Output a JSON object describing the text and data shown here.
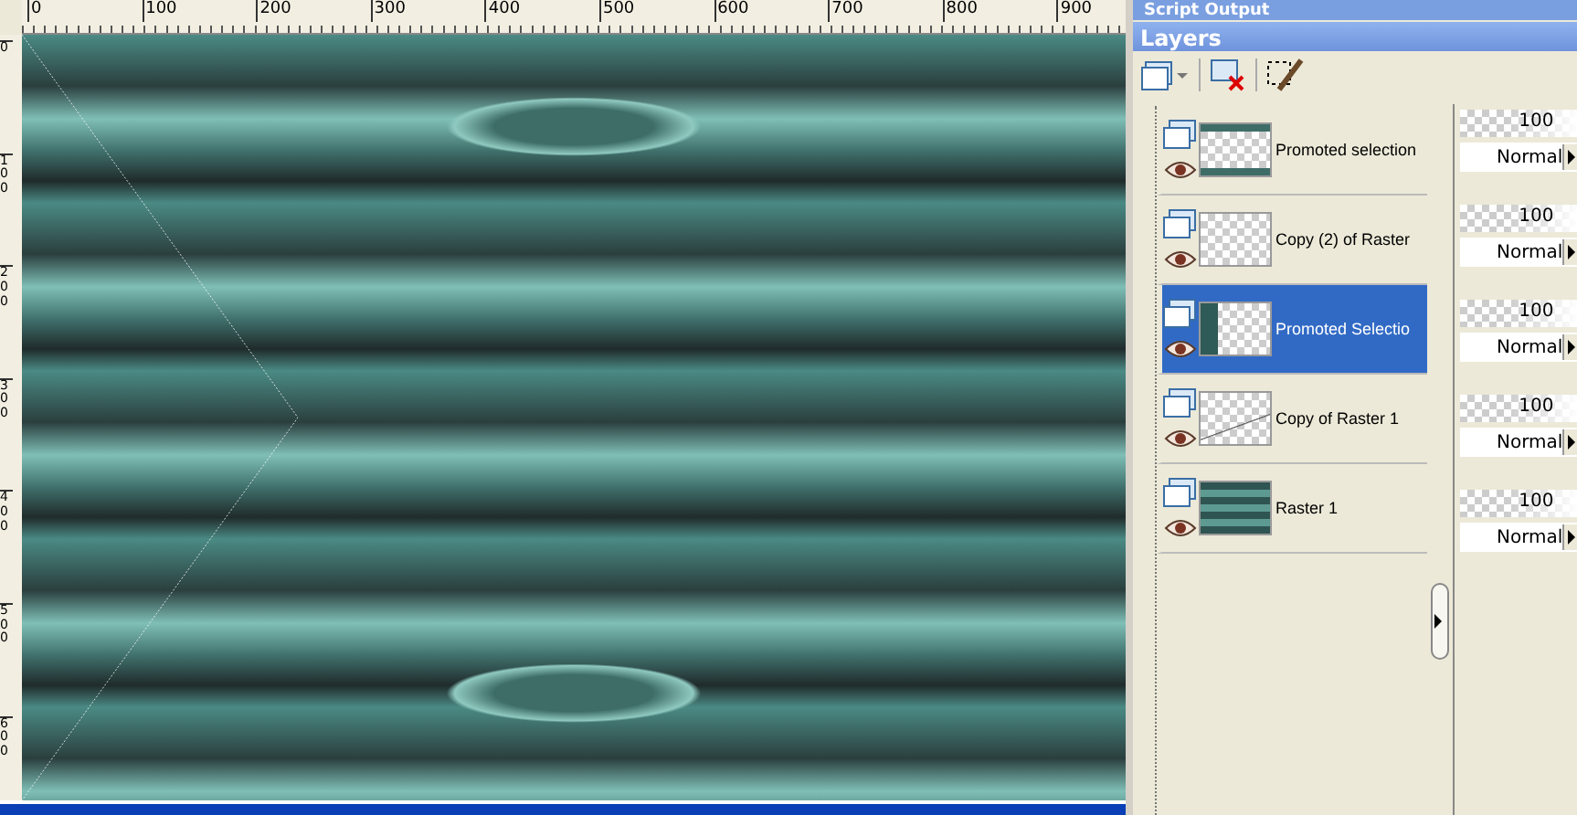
{
  "rulers": {
    "horizontal": [
      "0",
      "100",
      "200",
      "300",
      "400",
      "500",
      "600",
      "700",
      "800",
      "900"
    ],
    "vertical": [
      "0",
      "100",
      "200",
      "300",
      "400",
      "500",
      "600"
    ]
  },
  "script_output": {
    "title": "Script Output"
  },
  "layers_panel": {
    "title": "Layers",
    "layers": [
      {
        "name": "Promoted selection",
        "selected": false,
        "level": 1,
        "opacity": "100",
        "blend_mode": "Normal"
      },
      {
        "name": "Copy (2) of Raster",
        "selected": false,
        "level": 1,
        "opacity": "100",
        "blend_mode": "Normal"
      },
      {
        "name": "Promoted Selectio",
        "selected": true,
        "level": 1,
        "opacity": "100",
        "blend_mode": "Normal"
      },
      {
        "name": "Copy of Raster 1",
        "selected": false,
        "level": 1,
        "opacity": "100",
        "blend_mode": "Normal"
      },
      {
        "name": "Raster 1",
        "selected": false,
        "level": 1,
        "opacity": "100",
        "blend_mode": "Normal"
      }
    ]
  }
}
